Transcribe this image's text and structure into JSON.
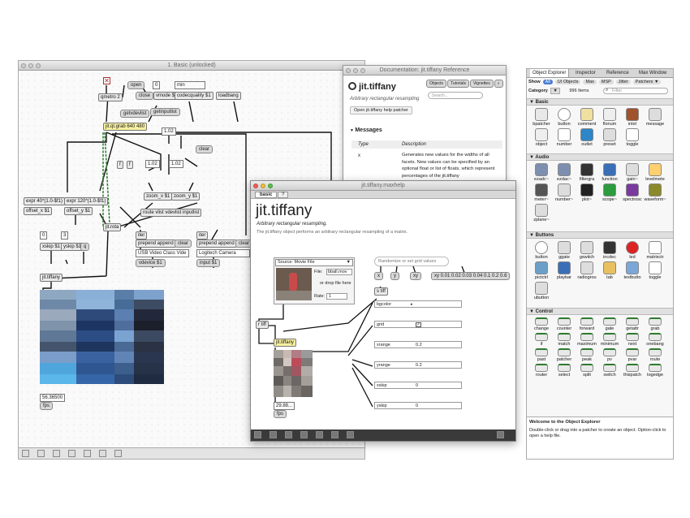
{
  "patcher": {
    "title": "1. Basic (unlocked)",
    "objects": {
      "open": "open",
      "close": "close",
      "num0": "0",
      "min": "min",
      "qmetro": "qmetro 2",
      "getvdevlist": "getvdevlist",
      "getinputlist": "getinputlist",
      "vmode": "vmode $1",
      "codecquality": "codecquality $1",
      "loadbang": "loadbang",
      "jitqtgrab": "jit.qt.grab 640 480",
      "n102a": "1.02",
      "n102b": "1.02",
      "n102c": "1.02",
      "clear": "clear",
      "zoomx": "zoom_x $1",
      "zoomy": "zoom_y $1",
      "expr1": "expr 40*(1.0-$f1)",
      "expr2": "expr 120*(1.0-$f1)",
      "offsetx": "offset_x $1",
      "offsety": "offset_y $1",
      "jitxfade": "jit.rota",
      "vlist": "route vlist vdevlist inputlist",
      "iter1": "iter",
      "iter2": "iter",
      "prepend1": "prepend append",
      "clear1": "clear",
      "prepend2": "prepend append",
      "clear2": "clear",
      "usbvideo": "USB Video Class Vide",
      "logitech": "Logitech Camera",
      "vdevice": "vdevice $1",
      "input": "input $1",
      "xskip_n": "0",
      "yskip_n": "3",
      "xskip": "xskip $1",
      "yskip": "yskip $1",
      "q": "q",
      "jittiffany": "jit.tiffany",
      "fps_value": "56.36500",
      "fps": "fps"
    }
  },
  "doc": {
    "title": "Documentation: jit.tiffany Reference",
    "name": "jit.tiffany",
    "subtitle": "Arbitrary rectangular resampling",
    "tabs": [
      "Objects",
      "Tutorials",
      "Vignettes"
    ],
    "search_placeholder": "Search...",
    "open_help": "Open jit.tiffany help patcher",
    "messages_header": "Messages",
    "col_type": "Type",
    "col_desc": "Description",
    "msg_name": "x",
    "msg_desc": "Generates new values for the widths of all facets. New values can be specified by an optional float or list of floats, which represent percentages of the jit.tiffany"
  },
  "help": {
    "title": "jit.tiffany.maxhelp",
    "tabs": [
      "basic",
      "?"
    ],
    "name": "jit.tiffany",
    "subtitle": "Arbitrary rectangular resampling.",
    "desc": "The jit.tiffany object performs an arbitrary rectangular resampling of a matrix.",
    "source": "Source: Movie File",
    "file_label": "File:",
    "file_value": "bball.mov",
    "drop": "or drop file here",
    "rate_label": "Rate:",
    "rate_value": "1",
    "randomize": "Randomize or set grid values",
    "btn_x": "x",
    "btn_y": "y",
    "btn_xy": "xy",
    "xy_list": "xy 0.01 0.02 0.03 0.04 0.1 0.2 0.6",
    "s_tiff": "s tiff",
    "r_tiff": "r tiff",
    "obj": "jit.tiffany",
    "params": [
      {
        "label": "bgcolor",
        "value": ""
      },
      {
        "label": "grid",
        "value": "✓"
      },
      {
        "label": "xrange",
        "value": "0.2"
      },
      {
        "label": "yrange",
        "value": "0.2"
      },
      {
        "label": "xskip",
        "value": "0"
      },
      {
        "label": "yskip",
        "value": "0"
      }
    ],
    "fps_value": "29.88...",
    "fps": "fps"
  },
  "explorer": {
    "tabs": [
      "Object Explorer",
      "Inspector",
      "Reference",
      "Max Window"
    ],
    "show_label": "Show",
    "filters": [
      "All",
      "UI Objects",
      "Max",
      "MSP",
      "Jitter",
      "Patchers ▼"
    ],
    "category_label": "Category",
    "item_count": "996 Items",
    "filter_placeholder": "Filter",
    "sections": {
      "basic": "Basic",
      "audio": "Audio",
      "buttons": "Buttons",
      "control": "Control"
    },
    "basic_items": [
      "bpatcher",
      "button",
      "comment",
      "flonum",
      "inlet",
      "message",
      "object",
      "number",
      "outlet",
      "preset",
      "toggle"
    ],
    "audio_items": [
      "ezadc~",
      "ezdac~",
      "filtergraph~",
      "function",
      "gain~",
      "levelmeter~",
      "meter~",
      "number~",
      "plot~",
      "scope~",
      "spectroscope~",
      "waveform~",
      "zplane~"
    ],
    "button_items": [
      "button",
      "ggate",
      "gswitch",
      "incdec",
      "led",
      "matrixctrl",
      "pictctrl",
      "playbar",
      "radiogroup",
      "tab",
      "textbutton",
      "toggle",
      "ubutton"
    ],
    "control_items": [
      "change",
      "counter",
      "forward",
      "gate",
      "getattr",
      "grab",
      "if",
      "match",
      "maximum",
      "minimum",
      "next",
      "onebang",
      "past",
      "patcher",
      "peak",
      "pv",
      "pvar",
      "route",
      "router",
      "select",
      "split",
      "switch",
      "thispatcher",
      "togedge"
    ],
    "welcome_title": "Welcome to the Object Explorer",
    "welcome_text": "Double-click or drag into a patcher to create an object. Option-click to open a help file."
  },
  "colors": {
    "accent": "#4a7bd1",
    "patchcord": "#111111",
    "signal_cord": "#2f7a2f",
    "object_fill": "#eaeaea"
  }
}
